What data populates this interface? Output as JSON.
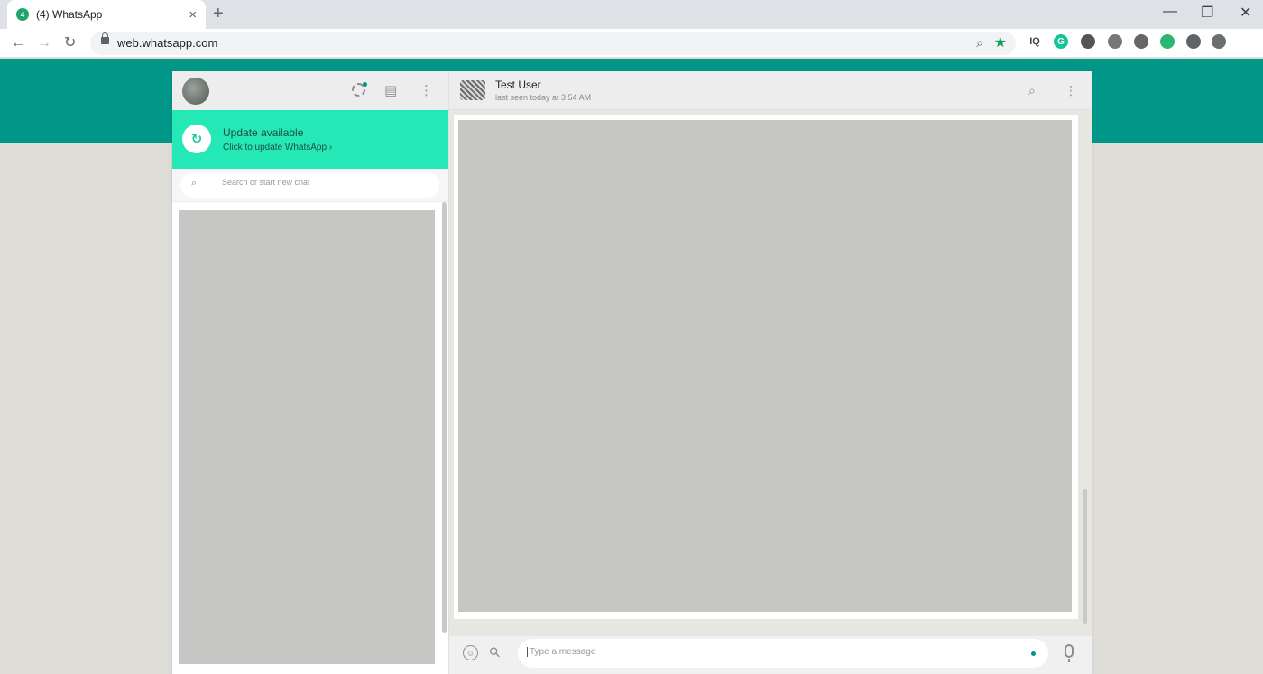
{
  "browser": {
    "tab_title": "(4) WhatsApp",
    "tab_favicon": "4",
    "tab_close": "×",
    "new_tab": "+",
    "url": "web.whatsapp.com",
    "window_minimize": "—",
    "window_restore": "❐",
    "window_close": "✕",
    "nav": {
      "back": "←",
      "forward": "→",
      "reload": "↻"
    },
    "extensions": [
      {
        "name": "iq-extension-icon",
        "label": "IQ",
        "color": "#444444"
      },
      {
        "name": "grammarly-icon",
        "label": "G",
        "color": "#15c39a"
      },
      {
        "name": "circle-extension-icon",
        "label": "",
        "color": "#555555"
      },
      {
        "name": "globe-extension-icon",
        "label": "",
        "color": "#777777"
      },
      {
        "name": "vpn-extension-icon",
        "label": "",
        "color": "#666666"
      },
      {
        "name": "android-extension-icon",
        "label": "",
        "color": "#2bb673"
      },
      {
        "name": "puzzle-extensions-icon",
        "label": "",
        "color": "#5f6368"
      },
      {
        "name": "profile-avatar-icon",
        "label": "",
        "color": "#6b6f6b"
      }
    ]
  },
  "sidebar": {
    "update": {
      "icon": "↻",
      "title": "Update available",
      "subtitle": "Click to update WhatsApp ›"
    },
    "search": {
      "placeholder": "Search or start new chat",
      "icon": "⌕"
    },
    "header_icons": {
      "new_chat": "▤",
      "menu": "⋮"
    }
  },
  "chat": {
    "contact_name": "Test User",
    "contact_status": "last seen today at 3:54 AM",
    "header_icons": {
      "search": "⌕",
      "menu": "⋮"
    },
    "compose": {
      "placeholder": "Type a message",
      "emoji": "☺",
      "attach": "⚲"
    }
  }
}
